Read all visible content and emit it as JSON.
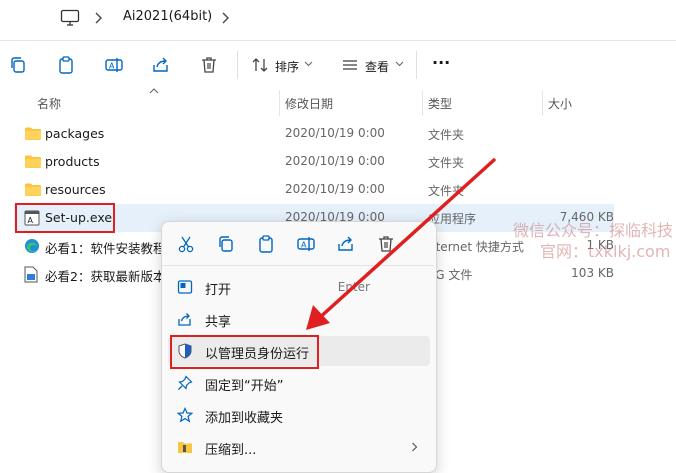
{
  "address_bar": {
    "breadcrumb": "Ai2021(64bit)"
  },
  "toolbar": {
    "sort_label": "排序",
    "view_label": "查看",
    "more": "···"
  },
  "columns": {
    "name": "名称",
    "date": "修改日期",
    "type": "类型",
    "size": "大小"
  },
  "files": [
    {
      "name": "packages",
      "date": "2020/10/19 0:00",
      "type": "文件夹",
      "size": "",
      "icon": "folder-icon"
    },
    {
      "name": "products",
      "date": "2020/10/19 0:00",
      "type": "文件夹",
      "size": "",
      "icon": "folder-icon"
    },
    {
      "name": "resources",
      "date": "2020/10/19 0:00",
      "type": "文件夹",
      "size": "",
      "icon": "folder-icon"
    },
    {
      "name": "Set-up.exe",
      "date": "2020/10/19 0:00",
      "type": "应用程序",
      "size": "7,460 KB",
      "icon": "app-icon"
    },
    {
      "name": "必看1：软件安装教程",
      "date": "",
      "type": "nternet 快捷方式",
      "size": "1 KB",
      "icon": "edge-shortcut-icon"
    },
    {
      "name": "必看2：获取最新版本",
      "date": "",
      "type": "PG 文件",
      "size": "103 KB",
      "icon": "image-file-icon"
    }
  ],
  "watermark": {
    "line1": "微信公众号：探临科技",
    "line2": "官网：txklkj.com"
  },
  "context_menu": {
    "quick_actions": [
      "cut-icon",
      "copy-icon",
      "paste-icon",
      "rename-icon",
      "share-icon",
      "delete-icon"
    ],
    "items": [
      {
        "label": "打开",
        "shortcut": "Enter",
        "icon": "open-icon"
      },
      {
        "label": "共享",
        "shortcut": "",
        "icon": "share-icon"
      },
      {
        "label": "以管理员身份运行",
        "shortcut": "",
        "icon": "shield-icon"
      },
      {
        "label": "固定到“开始”",
        "shortcut": "",
        "icon": "pin-icon"
      },
      {
        "label": "添加到收藏夹",
        "shortcut": "",
        "icon": "star-icon"
      },
      {
        "label": "压缩到...",
        "shortcut": "",
        "icon": "zip-icon"
      }
    ]
  },
  "colors": {
    "accent": "#0067c0",
    "folder": "#f8c640",
    "highlight_red": "#e02020",
    "selection": "#e5f0fb"
  }
}
